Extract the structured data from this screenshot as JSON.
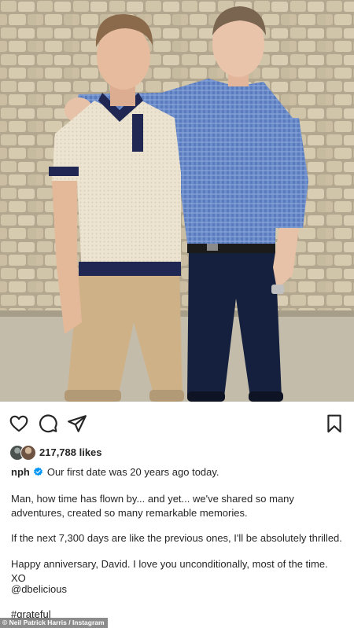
{
  "post": {
    "likes_count": "217,788 likes",
    "username": "nph",
    "caption_first_line": "Our first date was 20 years ago today.",
    "paragraphs": [
      "Man, how time has flown by... and yet... we've shared so many adventures, created so many remarkable memories.",
      "If the next 7,300 days are like the previous ones, I'll be absolutely thrilled.",
      "Happy anniversary, David. I love you unconditionally, most of the time. XO",
      "@dbelicious",
      "#grateful"
    ]
  },
  "photo_credit": "© Neil Patrick Harris / Instagram",
  "icons": {
    "like": "heart-icon",
    "comment": "comment-icon",
    "share": "paper-plane-icon",
    "save": "bookmark-icon",
    "verified": "verified-badge-icon"
  },
  "colors": {
    "text": "#262626",
    "verified_blue": "#0095f6"
  }
}
